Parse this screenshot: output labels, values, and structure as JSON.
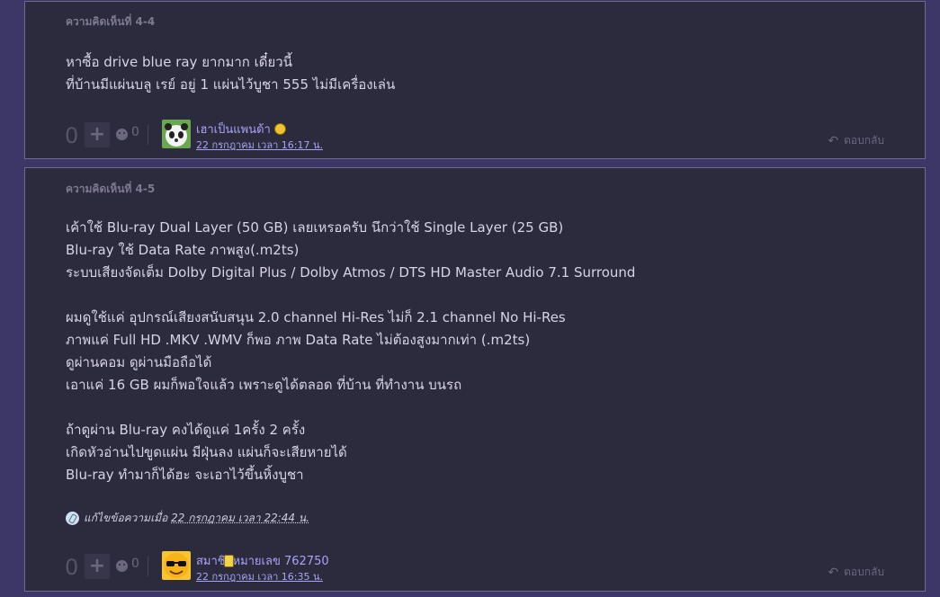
{
  "comments": [
    {
      "label": "ความคิดเห็นที่ 4-4",
      "body": "หาซื้อ drive blue ray ยากมาก เดี๋ยวนี้\nที่บ้านมีแผ่นบลู เรย์ อยู่ 1 แผ่นไว้บูชา 555 ไม่มีเครื่องเล่น",
      "votes": "0",
      "emotion_count": "0",
      "author": "เฮาเป็นแพนด้า",
      "time": "22 กรกฎาคม เวลา 16:17 น.",
      "reply": "ตอบกลับ"
    },
    {
      "label": "ความคิดเห็นที่ 4-5",
      "body": "เค้าใช้ Blu-ray Dual Layer (50 GB) เลยเหรอครับ นึกว่าใช้ Single Layer (25 GB)\nBlu-ray ใช้ Data Rate ภาพสูง(.m2ts)\nระบบเสียงจัดเต็ม Dolby Digital Plus / Dolby Atmos / DTS HD Master Audio 7.1 Surround\n\nผมดูใช้แค่ อุปกรณ์เสียงสนับสนุน 2.0 channel Hi-Res ไม่ก็ 2.1 channel No Hi-Res\nภาพแค่ Full HD .MKV .WMV ก็พอ ภาพ Data Rate ไม่ต้องสูงมากเท่า (.m2ts)\nดูผ่านคอม ดูผ่านมือถือได้\nเอาแค่ 16 GB ผมก็พอใจแล้ว เพราะดูได้ตลอด ที่บ้าน ที่ทำงาน บนรถ\n\nถ้าดูผ่าน Blu-ray คงได้ดูแค่ 1ครั้ง 2 ครั้ง\nเกิดหัวอ่านไปขูดแผ่น มีฝุ่นลง แผ่นก็จะเสียหายได้\nBlu-ray ทำมาก็ได้ฮะ จะเอาไว้ขึ้นหิ้งบูชา",
      "edit_prefix": "แก้ไขข้อความเมื่อ",
      "edit_time": "22 กรกฎาคม เวลา 22:44 น.",
      "votes": "0",
      "emotion_count": "0",
      "author": "สมาชิกหมายเลข 762750",
      "time": "22 กรกฎาคม เวลา 16:35 น.",
      "reply": "ตอบกลับ"
    }
  ]
}
